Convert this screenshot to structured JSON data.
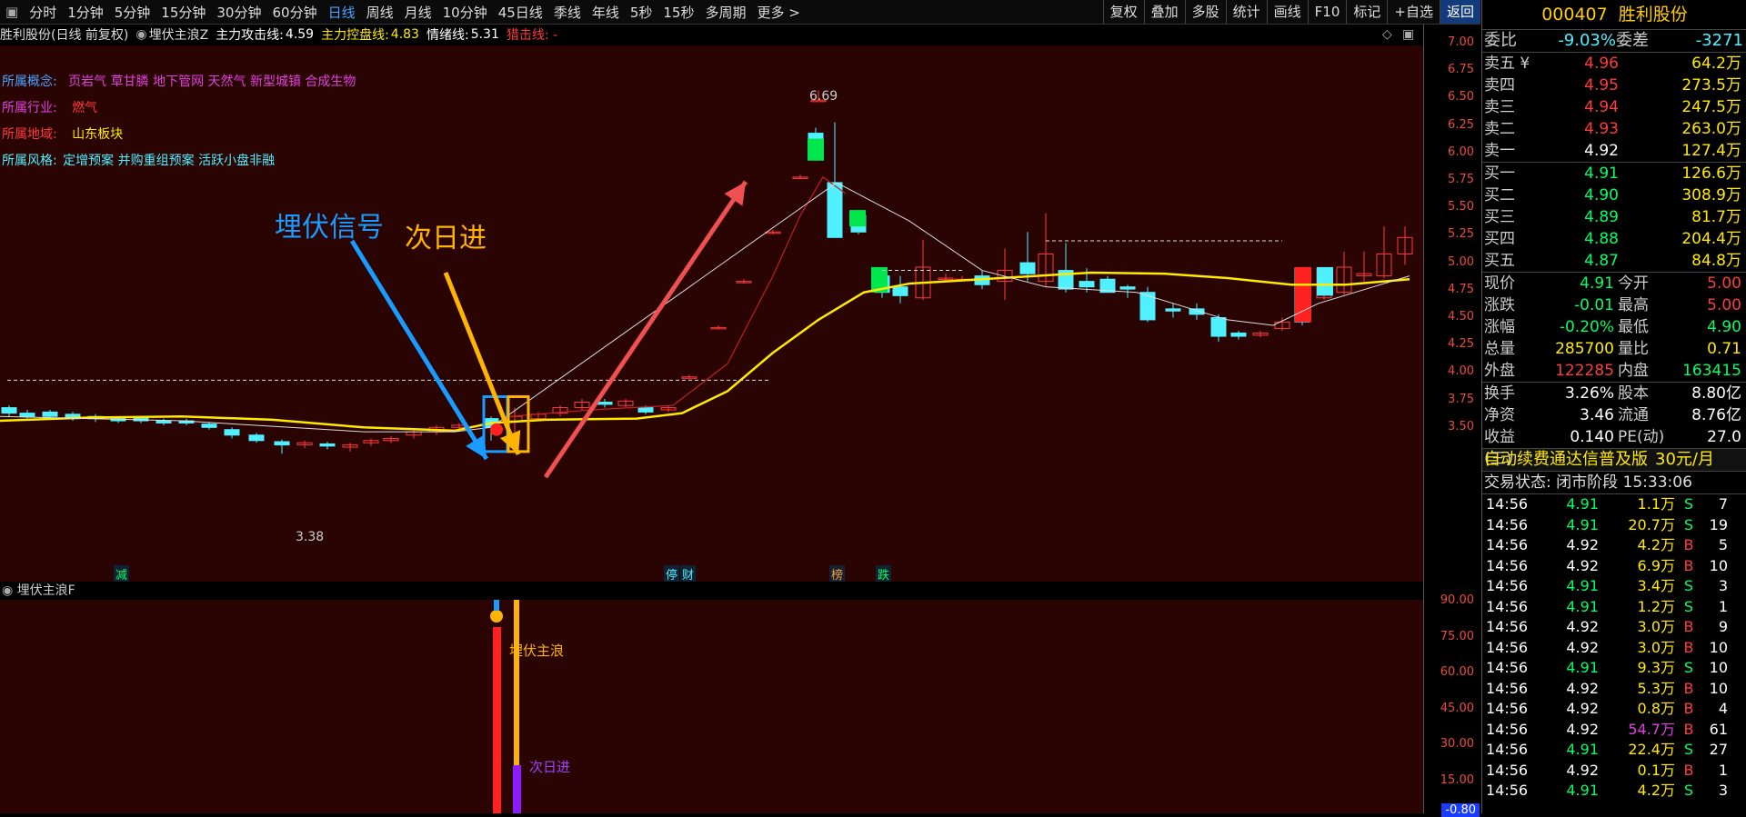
{
  "toolbar": {
    "timeframes": [
      "分时",
      "1分钟",
      "5分钟",
      "15分钟",
      "30分钟",
      "60分钟",
      "日线",
      "周线",
      "月线",
      "10分钟",
      "45日线",
      "季线",
      "年线",
      "5秒",
      "15秒",
      "多周期",
      "更多 >"
    ],
    "active": "日线",
    "buttons": [
      "复权",
      "叠加",
      "多股",
      "统计",
      "画线",
      "F10",
      "标记",
      "+自选",
      "返回"
    ]
  },
  "info": {
    "title": "胜利股份(日线 前复权)",
    "indicator": "埋伏主浪Z",
    "attack_label": "主力攻击线:",
    "attack_value": "4.59",
    "control_label": "主力控盘线:",
    "control_value": "4.83",
    "mood_label": "情绪线:",
    "mood_value": "5.31",
    "strike_label": "猎击线: -"
  },
  "concepts": {
    "concept_label": "所属概念:",
    "concept_value": "页岩气 草甘膦 地下管网 天然气 新型城镇 合成生物",
    "industry_label": "所属行业:",
    "industry_value": "燃气",
    "region_label": "所属地域:",
    "region_value": "山东板块",
    "style_label": "所属风格:",
    "style_value": "定增预案 并购重组预案 活跃小盘非融"
  },
  "annotations": {
    "signal": "埋伏信号",
    "next_day": "次日进",
    "high": "6.69",
    "low": "3.38",
    "sub_label1": "埋伏主浪",
    "sub_label2": "次日进",
    "markers": [
      "减",
      "停",
      "财",
      "榜",
      "跌"
    ]
  },
  "subchart": {
    "title": "埋伏主浪F"
  },
  "price_axis": [
    "7.00",
    "6.75",
    "6.50",
    "6.25",
    "6.00",
    "5.75",
    "5.50",
    "5.25",
    "5.00",
    "4.75",
    "4.50",
    "4.25",
    "4.00",
    "3.75",
    "3.50"
  ],
  "sub_axis": [
    "90.00",
    "75.00",
    "60.00",
    "45.00",
    "30.00",
    "15.00",
    "-0.80"
  ],
  "stock": {
    "code": "000407",
    "name": "胜利股份"
  },
  "quote": {
    "weibi_label": "委比",
    "weibi": "-9.03%",
    "weicha_label": "委差",
    "weicha": "-3271",
    "sells": [
      {
        "label": "卖五 ¥",
        "price": "4.96",
        "vol": "64.2万"
      },
      {
        "label": "卖四",
        "price": "4.95",
        "vol": "273.5万"
      },
      {
        "label": "卖三",
        "price": "4.94",
        "vol": "247.5万"
      },
      {
        "label": "卖二",
        "price": "4.93",
        "vol": "263.0万"
      },
      {
        "label": "卖一",
        "price": "4.92",
        "vol": "127.4万"
      }
    ],
    "buys": [
      {
        "label": "买一",
        "price": "4.91",
        "vol": "126.6万"
      },
      {
        "label": "买二",
        "price": "4.90",
        "vol": "308.9万"
      },
      {
        "label": "买三",
        "price": "4.89",
        "vol": "81.7万"
      },
      {
        "label": "买四",
        "price": "4.88",
        "vol": "204.4万"
      },
      {
        "label": "买五",
        "price": "4.87",
        "vol": "84.8万"
      }
    ],
    "stats": [
      {
        "l1": "现价",
        "v1": "4.91",
        "l2": "今开",
        "v2": "5.00"
      },
      {
        "l1": "涨跌",
        "v1": "-0.01",
        "l2": "最高",
        "v2": "5.00"
      },
      {
        "l1": "涨幅",
        "v1": "-0.20%",
        "l2": "最低",
        "v2": "4.90"
      },
      {
        "l1": "总量",
        "v1": "285700",
        "l2": "量比",
        "v2": "0.71"
      },
      {
        "l1": "外盘",
        "v1": "122285",
        "l2": "内盘",
        "v2": "163415"
      }
    ],
    "stats2": [
      {
        "l1": "换手",
        "v1": "3.26%",
        "l2": "股本",
        "v2": "8.80亿"
      },
      {
        "l1": "净资",
        "v1": "3.46",
        "l2": "流通",
        "v2": "8.76亿"
      },
      {
        "l1": "收益(三)",
        "v1": "0.140",
        "l2": "PE(动)",
        "v2": "27.0"
      }
    ],
    "ad": "自动续费通达信普及版",
    "ad_price": "30元/月",
    "status": "交易状态: 闭市阶段 15:33:06"
  },
  "trades": [
    {
      "t": "14:56",
      "p": "4.91",
      "v": "1.1万",
      "s": "S",
      "n": "7"
    },
    {
      "t": "14:56",
      "p": "4.91",
      "v": "20.7万",
      "s": "S",
      "n": "19"
    },
    {
      "t": "14:56",
      "p": "4.92",
      "v": "4.2万",
      "s": "B",
      "n": "5"
    },
    {
      "t": "14:56",
      "p": "4.92",
      "v": "6.9万",
      "s": "B",
      "n": "10"
    },
    {
      "t": "14:56",
      "p": "4.91",
      "v": "3.4万",
      "s": "S",
      "n": "3"
    },
    {
      "t": "14:56",
      "p": "4.91",
      "v": "1.2万",
      "s": "S",
      "n": "1"
    },
    {
      "t": "14:56",
      "p": "4.92",
      "v": "3.0万",
      "s": "B",
      "n": "9"
    },
    {
      "t": "14:56",
      "p": "4.92",
      "v": "3.0万",
      "s": "B",
      "n": "10"
    },
    {
      "t": "14:56",
      "p": "4.91",
      "v": "9.3万",
      "s": "S",
      "n": "10"
    },
    {
      "t": "14:56",
      "p": "4.92",
      "v": "5.3万",
      "s": "B",
      "n": "10"
    },
    {
      "t": "14:56",
      "p": "4.92",
      "v": "0.8万",
      "s": "B",
      "n": "4"
    },
    {
      "t": "14:56",
      "p": "4.92",
      "v": "54.7万",
      "s": "B",
      "n": "61"
    },
    {
      "t": "14:56",
      "p": "4.91",
      "v": "22.4万",
      "s": "S",
      "n": "27"
    },
    {
      "t": "14:56",
      "p": "4.92",
      "v": "0.1万",
      "s": "B",
      "n": "1"
    },
    {
      "t": "14:56",
      "p": "4.91",
      "v": "4.2万",
      "s": "S",
      "n": "3"
    }
  ],
  "colors": {
    "up": "#ff3b3b",
    "down": "#4ff0ff",
    "yellow": "#ffea00",
    "green": "#00ff66",
    "blue": "#1a9bff",
    "orange": "#ffb400"
  }
}
